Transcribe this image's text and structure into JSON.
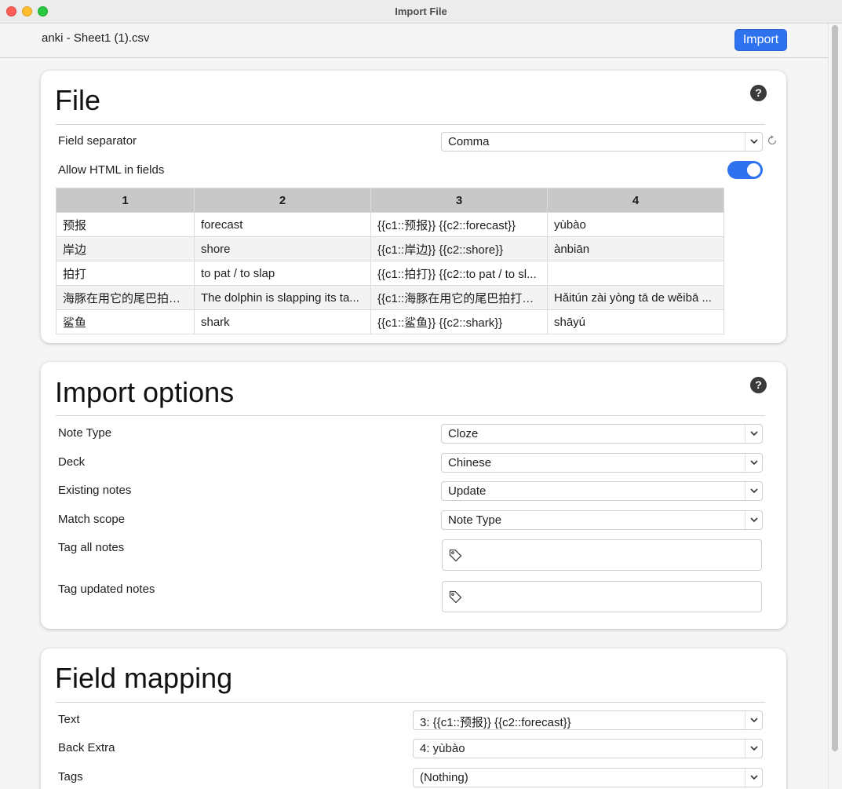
{
  "window": {
    "title": "Import File"
  },
  "header": {
    "filename": "anki - Sheet1 (1).csv",
    "import_label": "Import"
  },
  "file": {
    "title": "File",
    "help": "?",
    "field_separator_label": "Field separator",
    "field_separator_value": "Comma",
    "allow_html_label": "Allow HTML in fields",
    "allow_html_on": true,
    "columns": [
      "1",
      "2",
      "3",
      "4"
    ],
    "rows": [
      [
        "预报",
        "forecast",
        "{{c1::预报}} {{c2::forecast}}",
        "yùbào"
      ],
      [
        "岸边",
        "shore",
        "{{c1::岸边}} {{c2::shore}}",
        "ànbiān"
      ],
      [
        "拍打",
        "to pat / to slap",
        "{{c1::拍打}} {{c2::to pat / to sl...",
        ""
      ],
      [
        "海豚在用它的尾巴拍打。",
        "The dolphin is slapping its ta...",
        "{{c1::海豚在用它的尾巴拍打。...",
        "Hǎitún zài yòng tā de wěibā ..."
      ],
      [
        "鲨鱼",
        "shark",
        "{{c1::鲨鱼}} {{c2::shark}}",
        "shāyú"
      ]
    ]
  },
  "import_options": {
    "title": "Import options",
    "help": "?",
    "note_type_label": "Note Type",
    "note_type_value": "Cloze",
    "deck_label": "Deck",
    "deck_value": "Chinese",
    "existing_notes_label": "Existing notes",
    "existing_notes_value": "Update",
    "match_scope_label": "Match scope",
    "match_scope_value": "Note Type",
    "tag_all_label": "Tag all notes",
    "tag_updated_label": "Tag updated notes"
  },
  "field_mapping": {
    "title": "Field mapping",
    "text_label": "Text",
    "text_value": "3: {{c1::预报}} {{c2::forecast}}",
    "back_extra_label": "Back Extra",
    "back_extra_value": "4: yùbào",
    "tags_label": "Tags",
    "tags_value": "(Nothing)"
  }
}
